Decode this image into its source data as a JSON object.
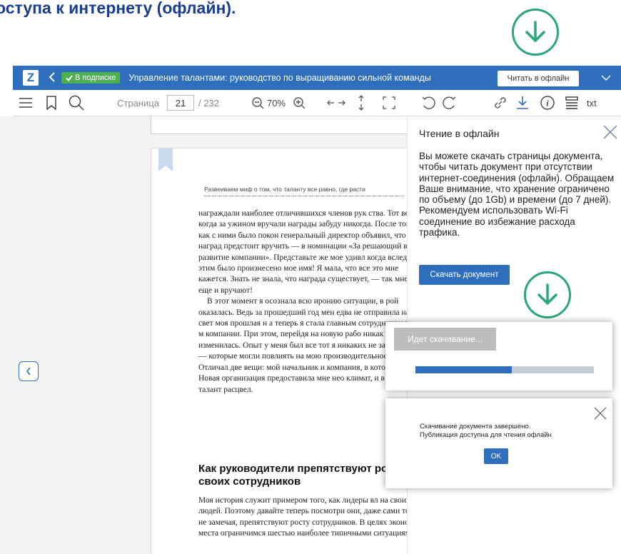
{
  "headline": "оступа к интернету (офлайн).",
  "titlebar": {
    "logo": "Z",
    "subscription_badge": "В подписке",
    "doc_title": "Управление талантами: руководство по выращиванию сильной команды",
    "offline_button": "Читать в офлайн"
  },
  "toolbar": {
    "page_label": "Страница",
    "page_value": "21",
    "page_total": "/ 232",
    "zoom": "70%",
    "txt_label": "txt"
  },
  "page": {
    "running_head": "Развеиваем миф о том, что таланту все равно, где расти",
    "paragraph1": "награждали наиболее отличившихся членов рук ства. Тот вечер, когда за ужином вручали награды забуду никогда. После того, как с ними было покон генеральный директор объявил, что одну наград предстоит вручить — в номинации «За решающий в развитие компании». Представьте же мое удивл когда вслед за этим было произнесено мое имя! Я мала, что все это мне кажется. Знать не знала, что награда существует, — так мне ее еще и вручают!",
    "paragraph2": "В этот момент я осознала всю иронию ситуации, в рой оказалась. Ведь за прошедший год мен едва не отправила на тот свет моя прошлая н а теперь я стала главным сотрудником года в м компании. При этом, перейдя на новую рабо никак не изменилась. Опыт у меня был все тот я никаких не заканчивала — которые могли повлиять на мою производительность. Отличал две вещи: мой начальник и компания, в котор тала. Новая организация предоставила мне нео климат, и в нем мой талант расцвел.",
    "section_title": "Как руководители препятствуют росту своих сотрудников",
    "paragraph3": "Моя история служит примером того, как лидеры вл на своих людей. Поэтому давайте теперь посмотри они, даже сами того не замечая, препятствуют росту сотрудников. В целях экономии места ограничимся шестью наиболее типичными ситуациями."
  },
  "panel": {
    "title": "Чтение в офлайн",
    "description": "Вы можете скачать страницы документа, чтобы читать документ при отсутствии интернет-соединения (офлайн). Обращаем Ваше внимание, что хранение ограничено по объему (до 1Gb) и времени (до 7 дней). Рекомендуем использовать Wi-Fi соединение во избежание расхода трафика.",
    "download_button": "Скачать документ"
  },
  "progress_popup": {
    "label": "Идет скачивание...",
    "progress_fraction": 0.54
  },
  "done_popup": {
    "line1": "Скачивание документа завершено.",
    "line2": "Публикация доступна для чтения офлайн",
    "ok_button": "OK"
  },
  "colors": {
    "brand_blue": "#2e6ebd",
    "badge_green": "#4caf50",
    "accent_green": "#2aa679",
    "headline_blue": "#1a3d8f"
  },
  "icons": [
    "download-circle-icon",
    "check-icon",
    "chevron-left-icon",
    "chevron-down-icon",
    "list-icon",
    "bookmark-icon",
    "search-icon",
    "zoom-out-icon",
    "zoom-in-icon",
    "fit-width-icon",
    "fit-height-icon",
    "fullscreen-icon",
    "rotate-left-icon",
    "rotate-right-icon",
    "link-icon",
    "download-icon",
    "info-icon",
    "layers-icon",
    "close-icon"
  ]
}
